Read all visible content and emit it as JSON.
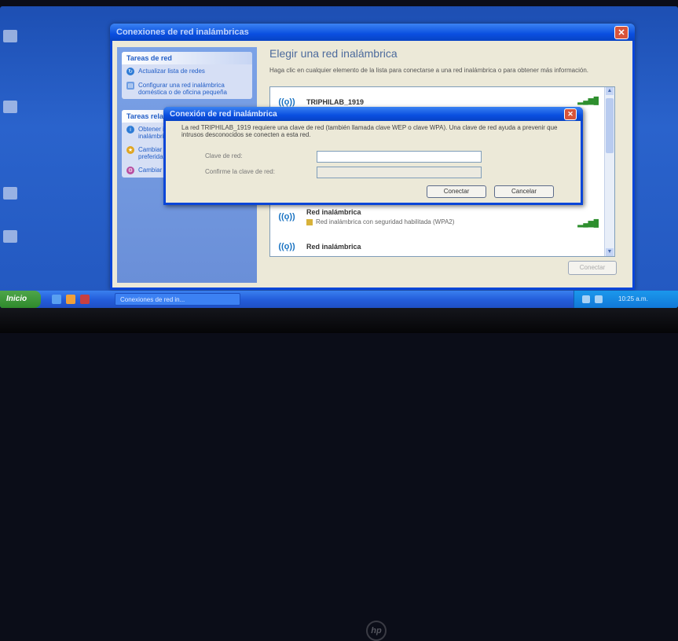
{
  "window": {
    "title": "Conexiones de red inalámbricas",
    "content_title": "Elegir una red inalámbrica",
    "content_desc": "Haga clic en cualquier elemento de la lista para conectarse a una red inalámbrica o para obtener más información.",
    "connect_label": "Conectar"
  },
  "sidebar": {
    "panels": [
      {
        "header": "Tareas de red",
        "items": [
          "Actualizar lista de redes",
          "Configurar una red inalámbrica doméstica o de oficina pequeña"
        ]
      },
      {
        "header": "Tareas relacionadas",
        "items": [
          "Obtener información acerca de redes inalámbricas",
          "Cambiar el orden de las redes preferidas",
          "Cambiar la configuración avanzada"
        ]
      }
    ]
  },
  "networks": [
    {
      "name": "TRIPHILAB_1919",
      "sub": ""
    },
    {
      "name": "Red inalámbrica",
      "sub": "Red inalámbrica con seguridad habilitada (WPA2)"
    },
    {
      "name": "Red inalámbrica",
      "sub": ""
    }
  ],
  "dialog": {
    "title": "Conexión de red inalámbrica",
    "message": "La red TRIPHILAB_1919 requiere una clave de red (también llamada clave WEP o clave WPA). Una clave de red ayuda a prevenir que intrusos desconocidos se conecten a esta red.",
    "key_label": "Clave de red:",
    "key_value": "",
    "confirm_label": "Confirme la clave de red:",
    "connect_label": "Conectar",
    "cancel_label": "Cancelar"
  },
  "taskbar": {
    "start_label": "Inicio",
    "task_label": "Conexiones de red in...",
    "clock": "10:25 a.m."
  },
  "colors": {
    "xp_blue": "#0a46d8",
    "desktop": "#2358c0",
    "start_green": "#2f8a2c"
  }
}
